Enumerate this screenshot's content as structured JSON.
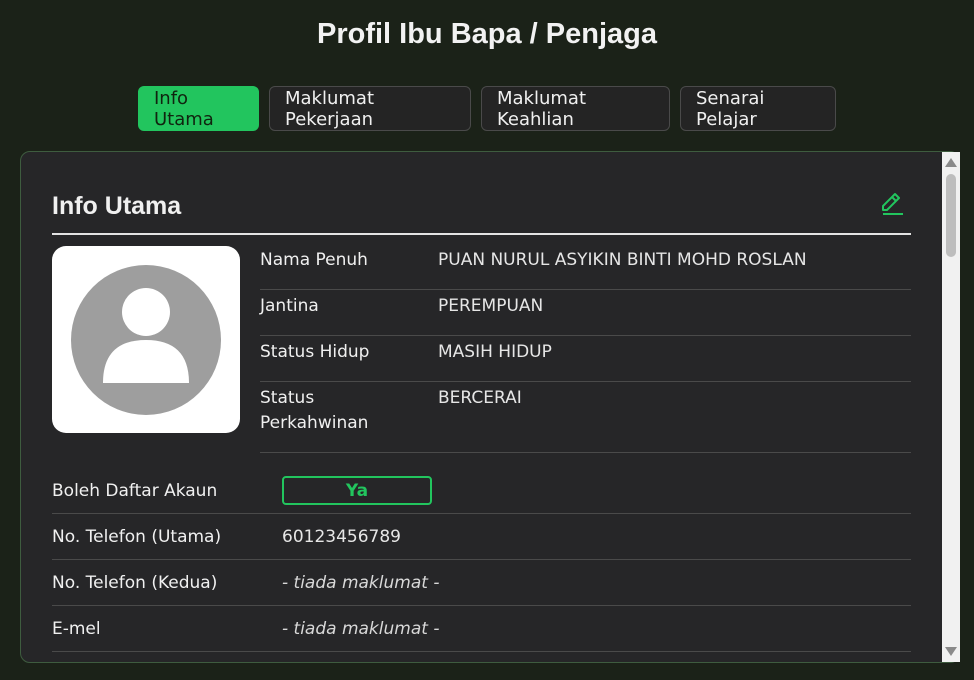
{
  "page": {
    "title": "Profil Ibu Bapa / Penjaga"
  },
  "tabs": [
    {
      "label": "Info Utama",
      "active": true
    },
    {
      "label": "Maklumat Pekerjaan",
      "active": false
    },
    {
      "label": "Maklumat Keahlian",
      "active": false
    },
    {
      "label": "Senarai Pelajar",
      "active": false
    }
  ],
  "card": {
    "title": "Info Utama",
    "edit_icon": "pencil-icon",
    "avatar_icon": "user-avatar-icon",
    "info": [
      {
        "label": "Nama Penuh",
        "value": "PUAN NURUL ASYIKIN BINTI MOHD ROSLAN"
      },
      {
        "label": "Jantina",
        "value": "PEREMPUAN"
      },
      {
        "label": "Status Hidup",
        "value": "MASIH HIDUP"
      },
      {
        "label": "Status Perkahwinan",
        "value": "BERCERAI"
      }
    ],
    "details": [
      {
        "label": "Boleh Daftar Akaun",
        "value": "Ya"
      },
      {
        "label": "No. Telefon (Utama)",
        "value": "60123456789"
      },
      {
        "label": "No. Telefon (Kedua)",
        "value": "- tiada maklumat -"
      },
      {
        "label": "E-mel",
        "value": "- tiada maklumat -"
      }
    ]
  },
  "colors": {
    "accent": "#22c55e",
    "background": "#1b2218",
    "card": "#262628"
  }
}
